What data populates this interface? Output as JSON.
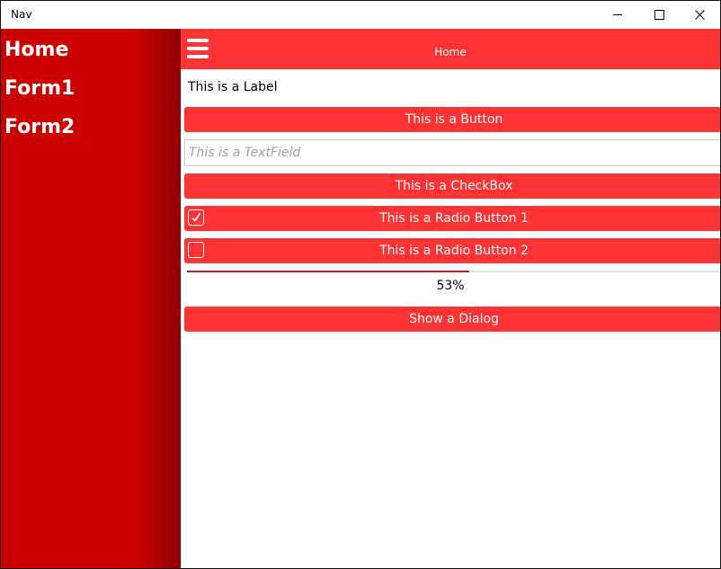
{
  "window": {
    "title": "Nav",
    "controls": [
      "minimize-icon",
      "maximize-icon",
      "close-icon"
    ]
  },
  "sidebar": {
    "items": [
      {
        "label": "Home"
      },
      {
        "label": "Form1"
      },
      {
        "label": "Form2"
      }
    ]
  },
  "header": {
    "title": "Home",
    "menu_icon": "hamburger-menu-icon"
  },
  "content": {
    "label": "This is a Label",
    "button_label": "This is a Button",
    "textfield_placeholder": "This is a TextField",
    "textfield_value": "",
    "checkbox_label": "This is a CheckBox",
    "radio1": {
      "label": "This is a Radio Button 1",
      "checked": true
    },
    "radio2": {
      "label": "This is a Radio Button 2",
      "checked": false
    },
    "progress": {
      "value": 0.53,
      "text": "53%"
    },
    "dialog_button_label": "Show a Dialog"
  },
  "colors": {
    "accent": "#ff3333",
    "sidebar": "#cc0000",
    "progress": "#cc1a1a"
  }
}
